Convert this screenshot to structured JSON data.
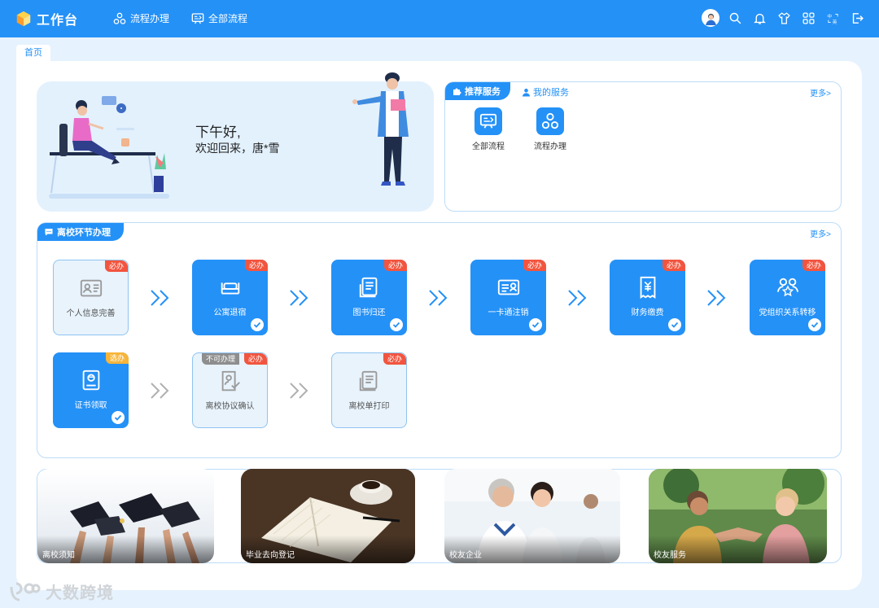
{
  "header": {
    "app_title": "工作台",
    "nav": [
      {
        "label": "流程办理",
        "icon": "flow-icon"
      },
      {
        "label": "全部流程",
        "icon": "all-flow-icon"
      }
    ],
    "right_icons": [
      "avatar",
      "search-icon",
      "bell-icon",
      "shirt-icon",
      "apps-grid-icon",
      "language-icon",
      "logout-icon"
    ]
  },
  "tabs": {
    "home": "首页"
  },
  "welcome": {
    "greeting": "下午好,",
    "message": "欢迎回来，唐*雪"
  },
  "recommend": {
    "tab_active": "推荐服务",
    "tab_inactive": "我的服务",
    "more": "更多>",
    "services": [
      {
        "label": "全部流程",
        "icon": "all-flow-icon"
      },
      {
        "label": "流程办理",
        "icon": "flow-icon"
      }
    ]
  },
  "leave": {
    "title": "离校环节办理",
    "more": "更多>",
    "steps": [
      {
        "label": "个人信息完善",
        "badge": "必办",
        "status": "pending",
        "icon": "id-card-icon"
      },
      {
        "label": "公寓退宿",
        "badge": "必办",
        "status": "done",
        "icon": "bed-icon"
      },
      {
        "label": "图书归还",
        "badge": "必办",
        "status": "done",
        "icon": "book-icon"
      },
      {
        "label": "一卡通注销",
        "badge": "必办",
        "status": "done",
        "icon": "card-icon"
      },
      {
        "label": "财务缴费",
        "badge": "必办",
        "status": "done",
        "icon": "bill-icon"
      },
      {
        "label": "党组织关系转移",
        "badge": "必办",
        "status": "done",
        "icon": "people-icon"
      },
      {
        "label": "证书领取",
        "badge": "选办",
        "status": "done",
        "icon": "certificate-icon"
      },
      {
        "label": "离校协议确认",
        "badge": "必办",
        "badge_extra": "不可办理",
        "status": "pending",
        "icon": "agreement-icon"
      },
      {
        "label": "离校单打印",
        "badge": "必办",
        "status": "pending",
        "icon": "print-icon"
      }
    ]
  },
  "banners": [
    {
      "label": "离校须知"
    },
    {
      "label": "毕业去向登记"
    },
    {
      "label": "校友企业"
    },
    {
      "label": "校友服务"
    }
  ],
  "watermark": {
    "text": "大数跨境"
  },
  "colors": {
    "primary": "#2491f7",
    "badge_red": "#f2553f",
    "badge_orange": "#f7b53a",
    "badge_gray": "#8e8e8e",
    "background": "#e6f2fd"
  }
}
